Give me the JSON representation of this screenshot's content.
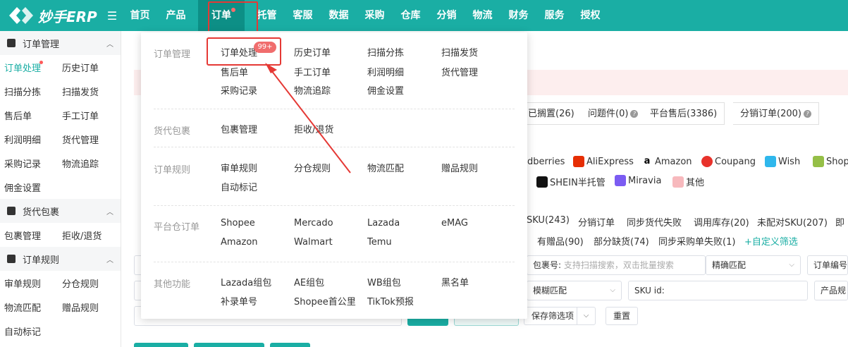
{
  "brand": {
    "name": "妙手ERP",
    "color": "#1aaea4"
  },
  "nav": {
    "items": [
      "首页",
      "产品",
      "订单",
      "托管",
      "客服",
      "数据",
      "采购",
      "仓库",
      "分销",
      "物流",
      "财务",
      "服务",
      "授权"
    ],
    "active": "订单"
  },
  "sidebar": {
    "groups": [
      {
        "title": "订单管理",
        "icon": "order-icon",
        "rows": [
          [
            "订单处理",
            "历史订单"
          ],
          [
            "扫描分拣",
            "扫描发货"
          ],
          [
            "售后单",
            "手工订单"
          ],
          [
            "利润明细",
            "货代管理"
          ],
          [
            "采购记录",
            "物流追踪"
          ],
          [
            "佣金设置",
            ""
          ]
        ]
      },
      {
        "title": "货代包裹",
        "icon": "package-icon",
        "rows": [
          [
            "包裹管理",
            "拒收/退货"
          ]
        ]
      },
      {
        "title": "订单规则",
        "icon": "rules-icon",
        "rows": [
          [
            "审单规则",
            "分仓规则"
          ],
          [
            "物流匹配",
            "赠品规则"
          ],
          [
            "自动标记",
            ""
          ]
        ]
      }
    ]
  },
  "content": {
    "status_tabs": [
      "已搁置(26)",
      "问题件(0)",
      "平台售后(3386)",
      "分销订单(200)"
    ],
    "platforms_row1": [
      "dberries",
      "AliExpress",
      "Amazon",
      "Coupang",
      "Wish",
      "Shopi"
    ],
    "platforms_row2": [
      "SHEIN半托管",
      "Miravia",
      "其他"
    ],
    "filters_row1": [
      "SKU(243)",
      "分销订单",
      "同步货代失败",
      "调用库存(20)",
      "未配对SKU(207)",
      "即"
    ],
    "filters_row2": [
      "有赠品(90)",
      "部分缺货(74)",
      "同步采购单失败(1)",
      "+自定义筛选"
    ],
    "package_label": "包裹号:",
    "package_placeholder": "支持扫描搜索，双击批量搜索",
    "match_exact": "精确匹配",
    "order_no": "订单编号",
    "match_fuzzy": "模糊匹配",
    "sku_label": "SKU id:",
    "product_label": "产品规",
    "save_filter": "保存筛选项",
    "reset": "重置"
  },
  "mega": {
    "sections": [
      {
        "title": "订单管理",
        "links": [
          "订单处理",
          "历史订单",
          "扫描分拣",
          "扫描发货",
          "售后单",
          "手工订单",
          "利润明细",
          "货代管理",
          "采购记录",
          "物流追踪",
          "佣金设置"
        ]
      },
      {
        "title": "货代包裹",
        "links": [
          "包裹管理",
          "拒收/退货"
        ]
      },
      {
        "title": "订单规则",
        "links": [
          "审单规则",
          "分仓规则",
          "物流匹配",
          "赠品规则",
          "自动标记"
        ]
      },
      {
        "title": "平台仓订单",
        "links": [
          "Shopee",
          "Mercado",
          "Lazada",
          "eMAG",
          "Amazon",
          "Walmart",
          "Temu"
        ]
      },
      {
        "title": "其他功能",
        "links": [
          "Lazada组包",
          "AE组包",
          "WB组包",
          "黑名单",
          "补录单号",
          "Shopee首公里",
          "TikTok预报"
        ]
      }
    ],
    "badge": "99+"
  }
}
